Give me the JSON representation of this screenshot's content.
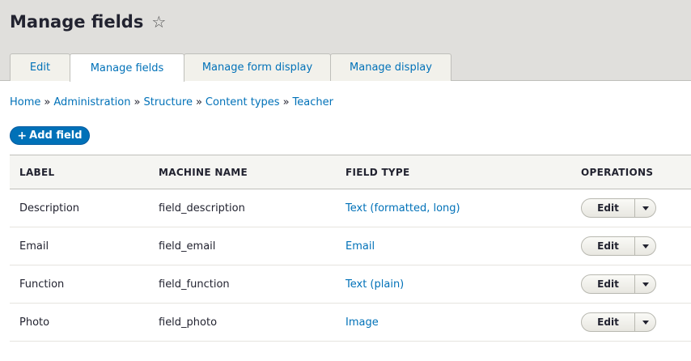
{
  "page": {
    "title": "Manage fields",
    "tabs": [
      {
        "label": "Edit",
        "active": false
      },
      {
        "label": "Manage fields",
        "active": true
      },
      {
        "label": "Manage form display",
        "active": false
      },
      {
        "label": "Manage display",
        "active": false
      }
    ]
  },
  "breadcrumb": {
    "items": [
      "Home",
      "Administration",
      "Structure",
      "Content types",
      "Teacher"
    ],
    "separator": "»"
  },
  "actions": {
    "add_field": "Add field",
    "add_icon": "+"
  },
  "table": {
    "headers": [
      "LABEL",
      "MACHINE NAME",
      "FIELD TYPE",
      "OPERATIONS"
    ],
    "rows": [
      {
        "label": "Description",
        "machine": "field_description",
        "type": "Text (formatted, long)",
        "op": "Edit"
      },
      {
        "label": "Email",
        "machine": "field_email",
        "type": "Email",
        "op": "Edit"
      },
      {
        "label": "Function",
        "machine": "field_function",
        "type": "Text (plain)",
        "op": "Edit"
      },
      {
        "label": "Photo",
        "machine": "field_photo",
        "type": "Image",
        "op": "Edit"
      }
    ]
  },
  "colors": {
    "link": "#0071b8",
    "header_bg": "#e0dfdc",
    "primary_button": "#0071b8"
  }
}
